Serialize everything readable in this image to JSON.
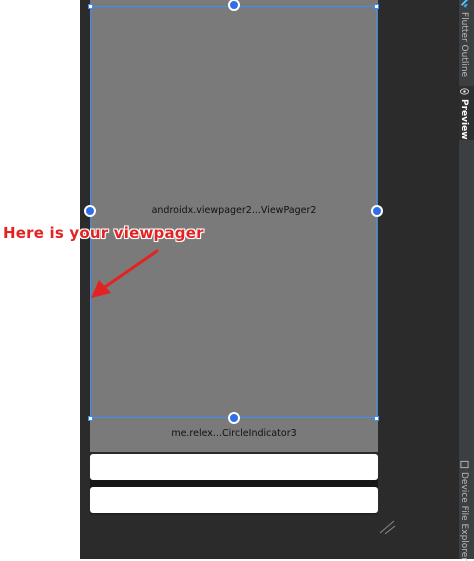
{
  "right_panel": {
    "tabs": [
      {
        "label": "Flutter Outline",
        "icon": "flutter-icon"
      },
      {
        "label": "Preview",
        "icon": "eye-icon"
      },
      {
        "label": "Device File Explorer",
        "icon": "device-icon"
      }
    ]
  },
  "preview": {
    "viewpager_label": "androidx.viewpager2...ViewPager2",
    "indicator_label": "me.relex...CircleIndicator3"
  },
  "annotation": {
    "text": "Here is your  viewpager"
  },
  "colors": {
    "ide_background": "#2b2b2b",
    "viewpager_fill": "#7a7a7a",
    "selection": "#3d8df5",
    "annotation": "#e32222"
  }
}
